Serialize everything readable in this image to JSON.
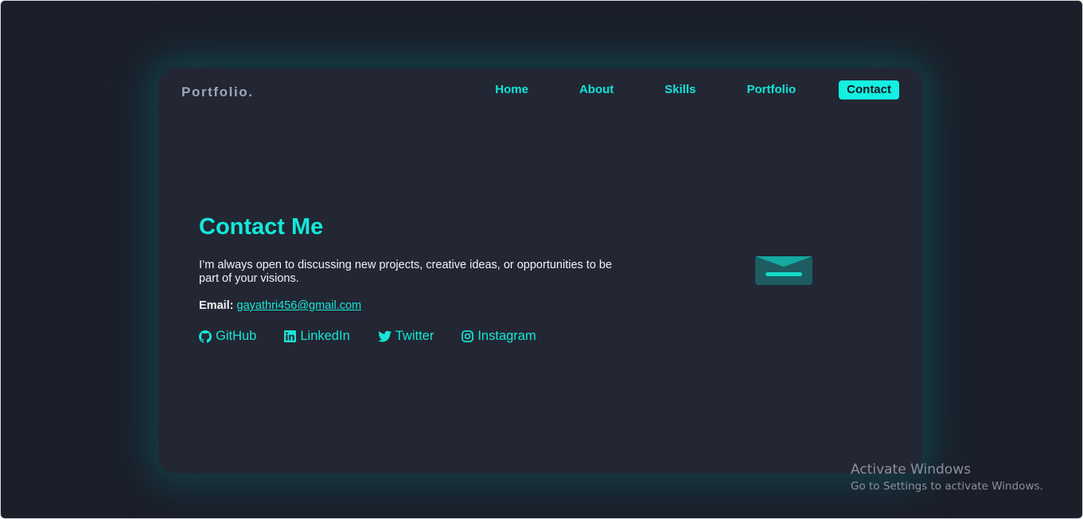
{
  "header": {
    "logo": "Portfolio.",
    "nav": [
      {
        "label": "Home",
        "active": false
      },
      {
        "label": "About",
        "active": false
      },
      {
        "label": "Skills",
        "active": false
      },
      {
        "label": "Portfolio",
        "active": false
      },
      {
        "label": "Contact",
        "active": true
      }
    ]
  },
  "contact": {
    "title": "Contact Me",
    "description": "I’m always open to discussing new projects, creative ideas, or opportunities to be part of your visions.",
    "email_label": "Email:",
    "email": "gayathri456@gmail.com",
    "socials": [
      {
        "label": "GitHub",
        "icon": "github-icon"
      },
      {
        "label": "LinkedIn",
        "icon": "linkedin-icon"
      },
      {
        "label": "Twitter",
        "icon": "twitter-icon"
      },
      {
        "label": "Instagram",
        "icon": "instagram-icon"
      }
    ],
    "illustration_icon": "envelope-icon"
  },
  "watermark": {
    "title": "Activate Windows",
    "subtitle": "Go to Settings to activate Windows."
  },
  "colors": {
    "background": "#1b1f2a",
    "card": "#222733",
    "accent": "#14e9dc",
    "text": "#f2f4f7",
    "logo": "#a0a6b3"
  }
}
